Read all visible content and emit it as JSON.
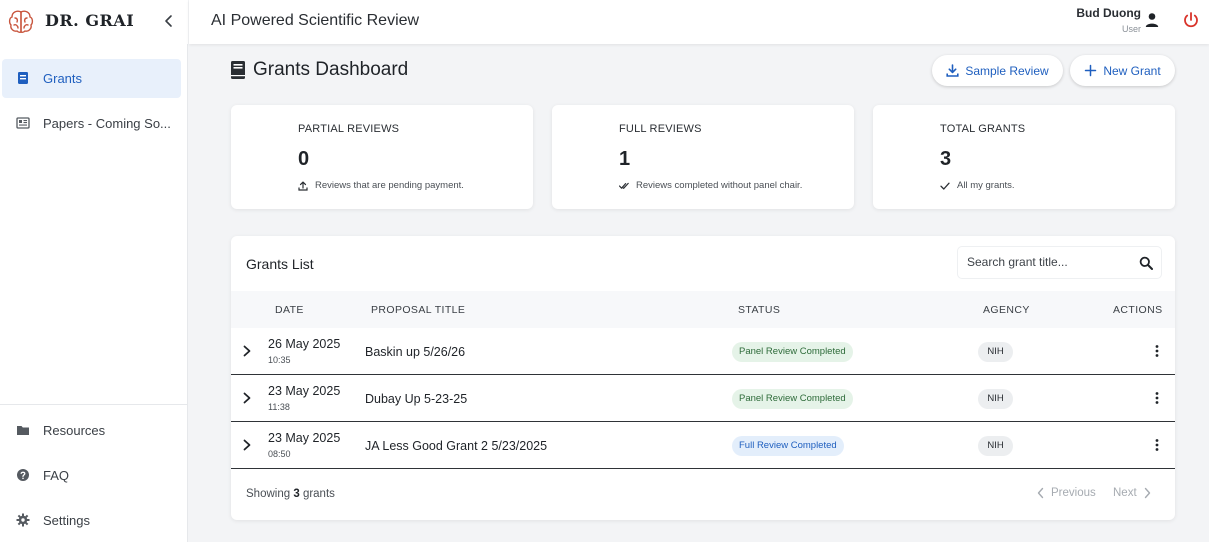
{
  "sidebar": {
    "brand": "DR. GRAI",
    "items": [
      {
        "label": "Grants",
        "icon": "grant-book-icon",
        "active": true
      },
      {
        "label": "Papers - Coming So...",
        "icon": "newspaper-icon",
        "active": false
      }
    ],
    "bottom_items": [
      {
        "label": "Resources",
        "icon": "folder-icon"
      },
      {
        "label": "FAQ",
        "icon": "help-circle-icon"
      },
      {
        "label": "Settings",
        "icon": "gear-icon"
      }
    ]
  },
  "topbar": {
    "title": "AI Powered Scientific Review",
    "user_name": "Bud Duong",
    "user_role": "User"
  },
  "dashboard": {
    "title": "Grants Dashboard",
    "sample_review_label": "Sample Review",
    "new_grant_label": "New Grant"
  },
  "stats": [
    {
      "title": "PARTIAL REVIEWS",
      "value": "0",
      "subtitle": "Reviews that are pending payment."
    },
    {
      "title": "FULL REVIEWS",
      "value": "1",
      "subtitle": "Reviews completed without panel chair."
    },
    {
      "title": "TOTAL GRANTS",
      "value": "3",
      "subtitle": "All my grants."
    }
  ],
  "grants_list": {
    "title": "Grants List",
    "search_placeholder": "Search grant title...",
    "columns": {
      "date": "DATE",
      "title": "PROPOSAL TITLE",
      "status": "STATUS",
      "agency": "AGENCY",
      "actions": "ACTIONS"
    },
    "rows": [
      {
        "date": "26 May 2025",
        "time": "10:35",
        "title": "Baskin up 5/26/26",
        "status": "Panel Review Completed",
        "status_type": "panel",
        "agency": "NIH"
      },
      {
        "date": "23 May 2025",
        "time": "11:38",
        "title": "Dubay Up 5-23-25",
        "status": "Panel Review Completed",
        "status_type": "panel",
        "agency": "NIH"
      },
      {
        "date": "23 May 2025",
        "time": "08:50",
        "title": "JA Less Good Grant 2 5/23/2025",
        "status": "Full Review Completed",
        "status_type": "full",
        "agency": "NIH"
      }
    ],
    "footer": {
      "showing_prefix": "Showing",
      "count": "3",
      "showing_suffix": "grants",
      "previous_label": "Previous",
      "next_label": "Next"
    }
  },
  "colors": {
    "accent": "#1f5fbf",
    "power": "#d9342b",
    "brand_logo": "#c8553d"
  }
}
